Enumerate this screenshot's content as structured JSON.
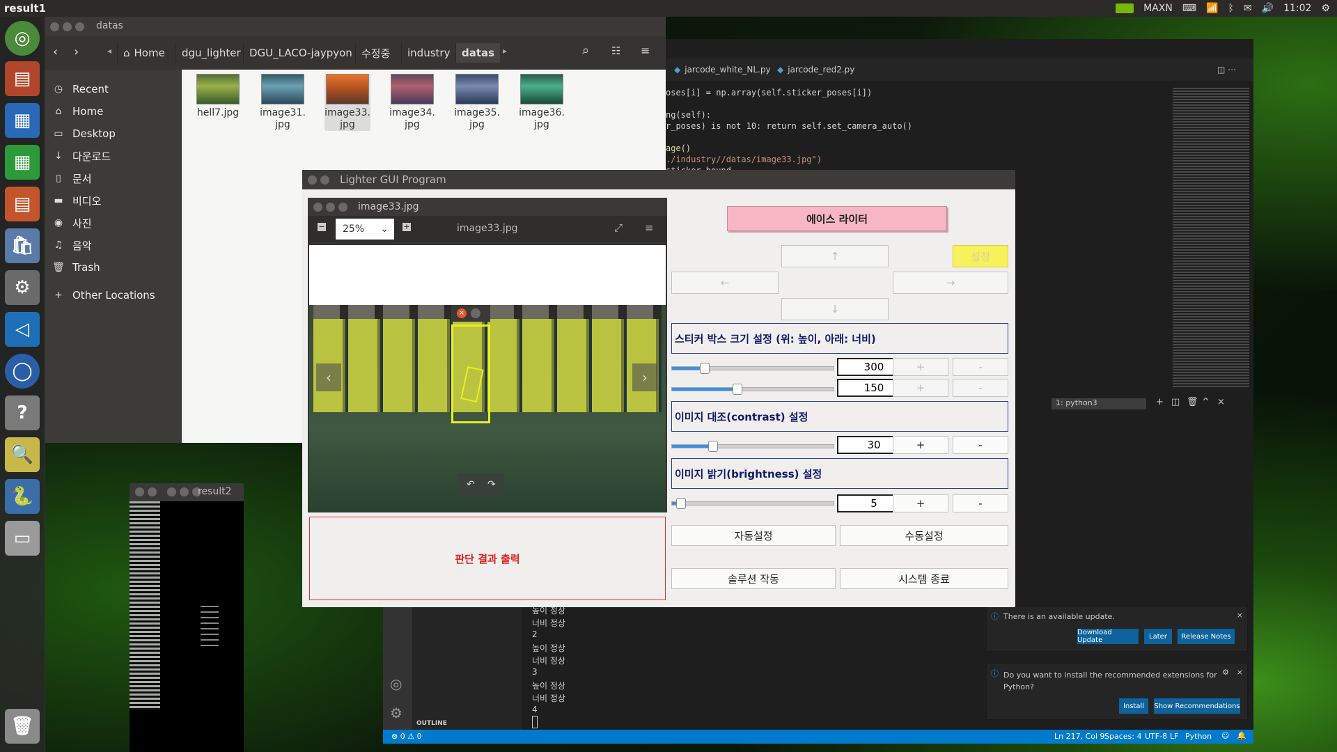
{
  "topbar": {
    "title": "result1",
    "power_mode": "MAXN",
    "time": "11:02"
  },
  "files": {
    "title": "datas",
    "breadcrumbs": [
      "Home",
      "dgu_lighter",
      "DGU_LACO-jaypyon",
      "수정중",
      "industry",
      "datas"
    ],
    "sidebar": [
      {
        "label": "Recent",
        "icon": "◷"
      },
      {
        "label": "Home",
        "icon": "⌂"
      },
      {
        "label": "Desktop",
        "icon": "▭"
      },
      {
        "label": "다운로드",
        "icon": "↓"
      },
      {
        "label": "문서",
        "icon": "▯"
      },
      {
        "label": "비디오",
        "icon": "▬"
      },
      {
        "label": "사진",
        "icon": "◉"
      },
      {
        "label": "음악",
        "icon": "♫"
      },
      {
        "label": "Trash",
        "icon": "🗑"
      },
      {
        "label": "Other Locations",
        "icon": "+"
      }
    ],
    "thumbnails": [
      {
        "name": "hell7.jpg",
        "color": "#6b8a3a"
      },
      {
        "name": "image31.\njpg",
        "color": "#3f6a7a"
      },
      {
        "name": "image33.\njpg",
        "color": "#d8682a"
      },
      {
        "name": "image34.\njpg",
        "color": "#7a5a6a"
      },
      {
        "name": "image35.\njpg",
        "color": "#4a5a7a"
      },
      {
        "name": "image36.\njpg",
        "color": "#2f7a5a"
      }
    ]
  },
  "vscode": {
    "tabs": [
      "jarcode_white_NL.py",
      "jarcode_red2.py"
    ],
    "code": [
      "oses[i] = np.array(self.sticker_poses[i])",
      "",
      "ng(self):",
      "r_poses) is not 10: return self.set_camera_auto()",
      "",
      "age()",
      "./industry//datas/image33.jpg\")",
      "sticker_bound"
    ],
    "terminal_select": "1: python3",
    "terminal_lines": [
      "높이 정상",
      "너비 정상",
      "2",
      "높이 정상",
      "너비 정상",
      "3",
      "높이 정상",
      "너비 정상",
      "4"
    ],
    "outline_label": "OUTLINE",
    "status_left": "⊗ 0 ⚠ 0",
    "status_right": [
      "Ln 217, Col 9",
      "Spaces: 4",
      "UTF-8",
      "LF",
      "Python"
    ],
    "notif1": {
      "text": "There is an available update.",
      "buttons": [
        "Download Update",
        "Later",
        "Release Notes"
      ]
    },
    "notif2": {
      "text": "Do you want to install the recommended extensions for Python?",
      "buttons": [
        "Install",
        "Show Recommendations"
      ]
    }
  },
  "result2": {
    "title": "result2"
  },
  "lighter": {
    "title": "Lighter GUI Program",
    "viewer_title": "image33.jpg",
    "viewer_filename": "image33.jpg",
    "zoom": "25%",
    "result_text": "판단 결과 출력",
    "brand_button": "에이스 라이터",
    "settings_button": "설정",
    "arrows": {
      "up": "↑",
      "down": "↓",
      "left": "←",
      "right": "→"
    },
    "sticker_section": "스티커 박스 크기 설정 (위: 높이, 아래: 너비)",
    "contrast_section": "이미지 대조(contrast) 설정",
    "brightness_section": "이미지 밝기(brightness) 설정",
    "sticker_height": "300",
    "sticker_width": "150",
    "contrast_value": "30",
    "brightness_value": "5",
    "sliders": {
      "height": 0.2,
      "width": 0.4,
      "contrast": 0.25,
      "brightness": 0.05
    },
    "plus": "+",
    "minus": "-",
    "auto_button": "자동설정",
    "manual_button": "수동설정",
    "solution_button": "솔루션 작동",
    "exit_button": "시스템 종료"
  }
}
